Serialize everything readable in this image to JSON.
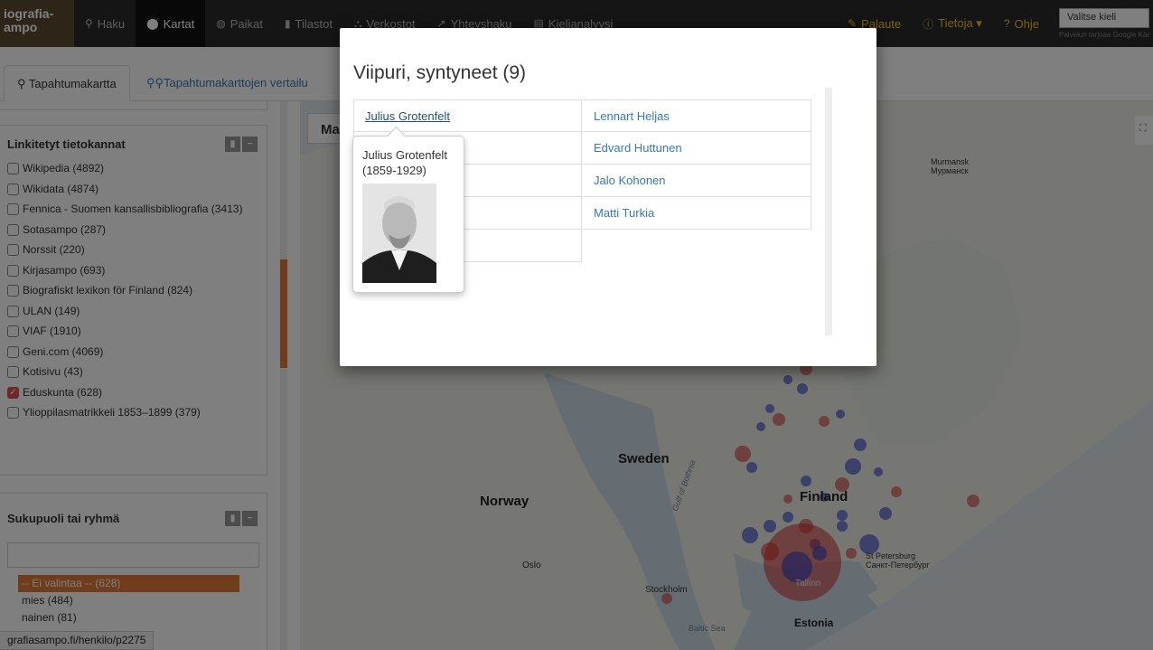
{
  "navbar": {
    "brand": "iografia-\nampo",
    "items": [
      {
        "label": "Haku",
        "icon": "search-icon"
      },
      {
        "label": "Kartat",
        "icon": "map-marker-icon"
      },
      {
        "label": "Paikat",
        "icon": "globe-icon"
      },
      {
        "label": "Tilastot",
        "icon": "bar-chart-icon"
      },
      {
        "label": "Verkostot",
        "icon": "network-icon"
      },
      {
        "label": "Yhteyshaku",
        "icon": "search-link-icon"
      },
      {
        "label": "Kielianalyysi",
        "icon": "book-icon"
      }
    ],
    "right_items": [
      {
        "label": "Palaute",
        "icon": "pencil-icon"
      },
      {
        "label": "Tietoja ▾",
        "icon": "info-icon"
      },
      {
        "label": "Ohje",
        "icon": "help-icon"
      }
    ],
    "language_select": "Valitse kieli",
    "translate_note": "Palvelun tarjoaa Google Kään"
  },
  "tabs": {
    "event_map": "Tapahtumakartta",
    "compare": "Tapahtumakarttojen vertailu"
  },
  "sidebar": {
    "linked_db": {
      "title": "Linkitetyt tietokannat",
      "items": [
        {
          "label": "Wikipedia (4892)",
          "checked": false
        },
        {
          "label": "Wikidata (4874)",
          "checked": false
        },
        {
          "label": "Fennica - Suomen kansallisbibliografia (3413)",
          "checked": false
        },
        {
          "label": "Sotasampo (287)",
          "checked": false
        },
        {
          "label": "Norssit (220)",
          "checked": false
        },
        {
          "label": "Kirjasampo (693)",
          "checked": false
        },
        {
          "label": "Biografiskt lexikon för Finland (824)",
          "checked": false
        },
        {
          "label": "ULAN (149)",
          "checked": false
        },
        {
          "label": "VIAF (1910)",
          "checked": false
        },
        {
          "label": "Geni.com (4069)",
          "checked": false
        },
        {
          "label": "Kotisivu (43)",
          "checked": false
        },
        {
          "label": "Eduskunta (628)",
          "checked": true
        },
        {
          "label": "Ylioppilasmatrikkeli 1853–1899 (379)",
          "checked": false
        }
      ]
    },
    "gender": {
      "title": "Sukupuoli tai ryhmä",
      "options": [
        "-- Ei valintaa -- (628)",
        "mies (484)",
        "nainen (81)"
      ]
    }
  },
  "map": {
    "tab_label": "Ma",
    "labels": {
      "sweden": "Sweden",
      "norway": "Norway",
      "finland": "Finland",
      "estonia": "Estonia",
      "murmansk": "Murmansk\nМурманск",
      "oslo": "Oslo",
      "stockholm": "Stockholm",
      "tallinn": "Tallinn",
      "st_petersburg": "St Petersburg\nСанкт-Петербург",
      "gulf": "Gulf of Bothnia",
      "baltic": "Baltic Sea"
    }
  },
  "status_url": "grafiasampo.fi/henkilo/p2275",
  "modal": {
    "title": "Viipuri, syntyneet (9)",
    "left_column": [
      "Julius Grotenfelt",
      "",
      "",
      "",
      ""
    ],
    "right_column": [
      "Lennart Heljas",
      "Edvard Huttunen",
      "Jalo Kohonen",
      "Matti Turkia"
    ]
  },
  "tooltip": {
    "name": "Julius Grotenfelt (1859-1929)"
  }
}
